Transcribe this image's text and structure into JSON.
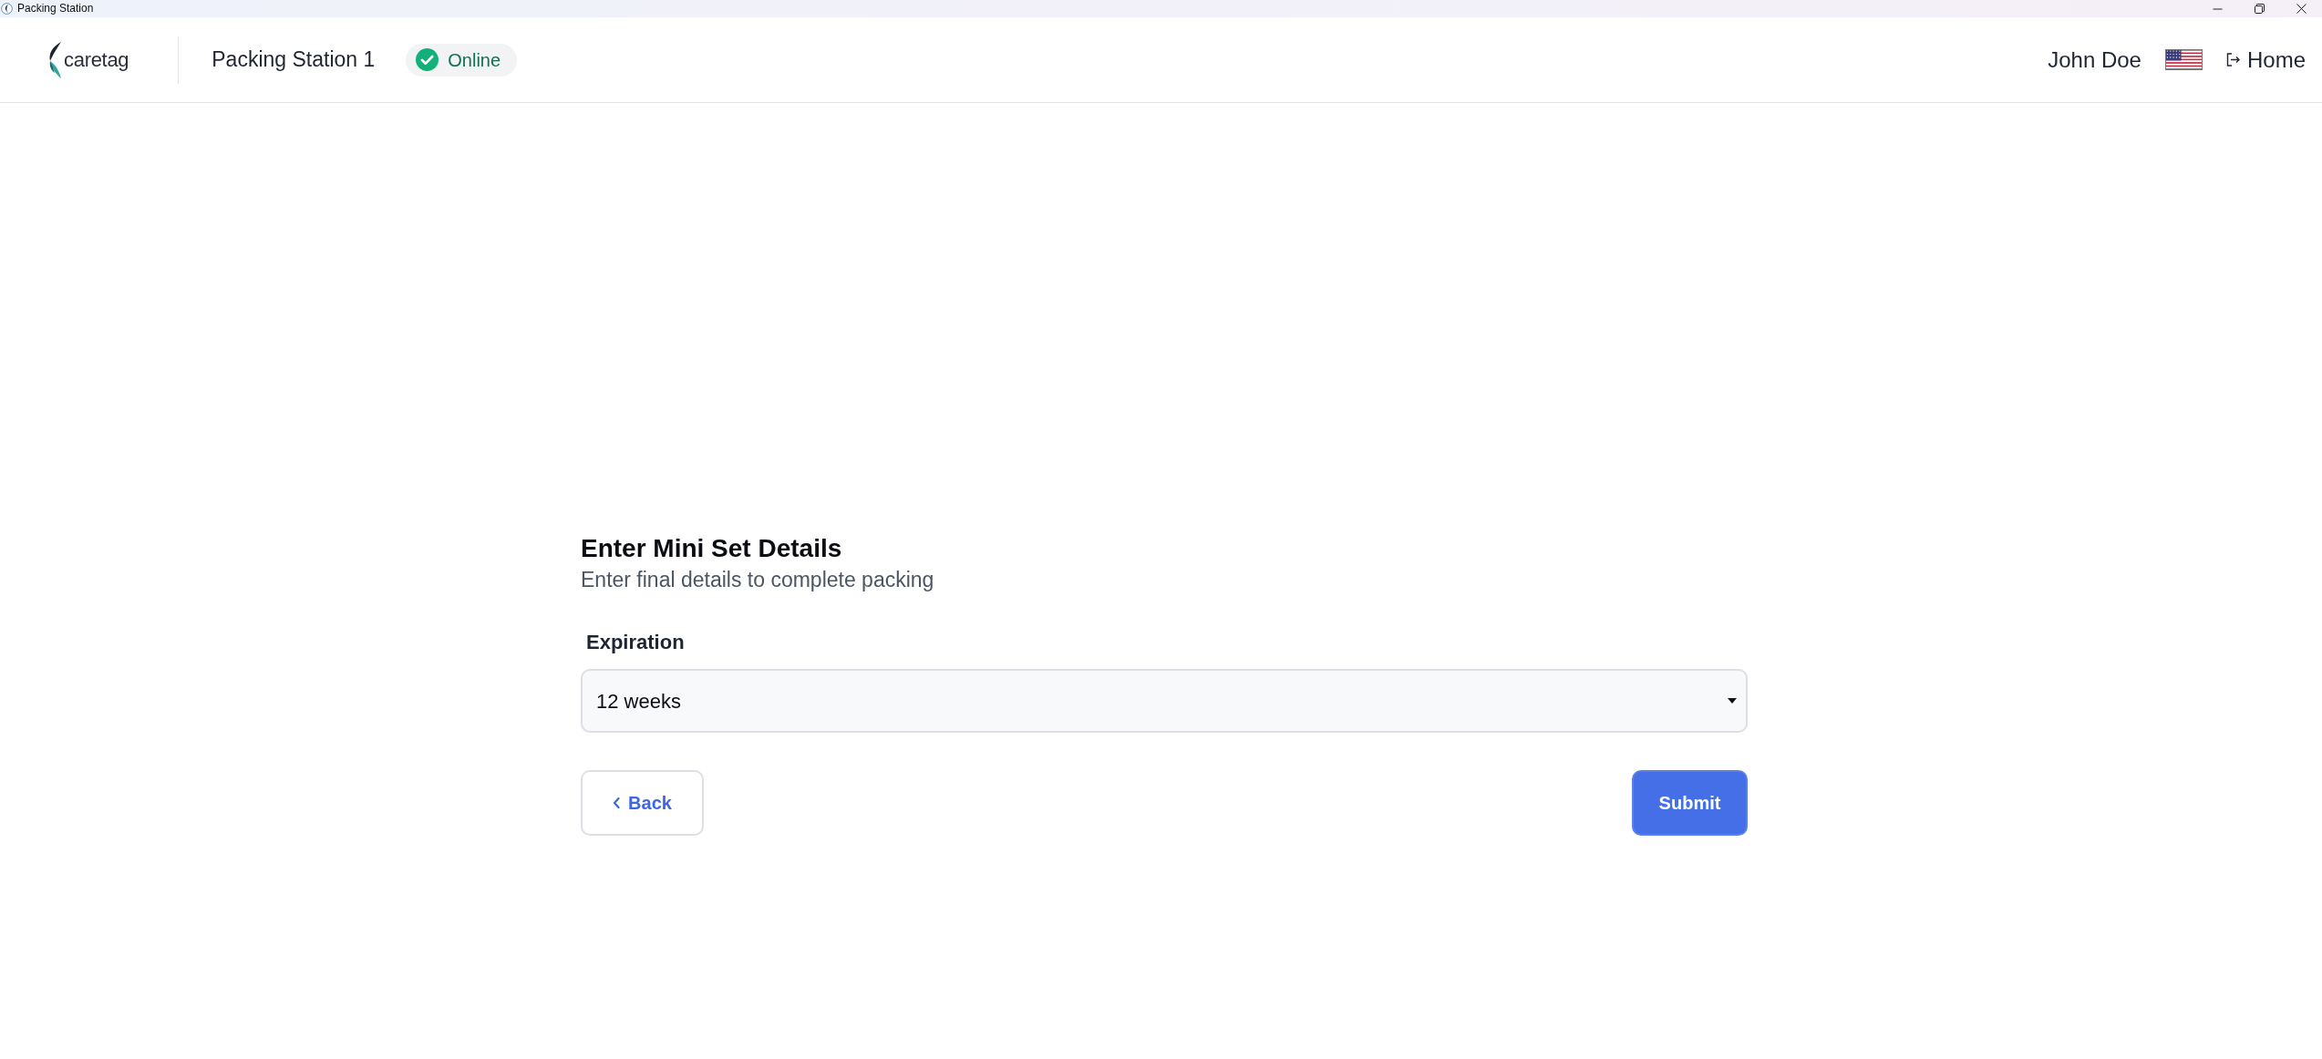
{
  "window": {
    "title": "Packing Station"
  },
  "header": {
    "logo": "caretag",
    "station": "Packing Station 1",
    "status": {
      "label": "Online",
      "online": true
    },
    "user": "John Doe",
    "home_link": "Home"
  },
  "form": {
    "title": "Enter Mini Set Details",
    "subtitle": "Enter final details to complete packing",
    "fields": [
      {
        "label": "Expiration",
        "kind": "select",
        "value": "12 weeks"
      }
    ],
    "buttons": [
      {
        "label": "Back",
        "kind": "secondary"
      },
      {
        "label": "Submit",
        "kind": "primary"
      }
    ]
  }
}
